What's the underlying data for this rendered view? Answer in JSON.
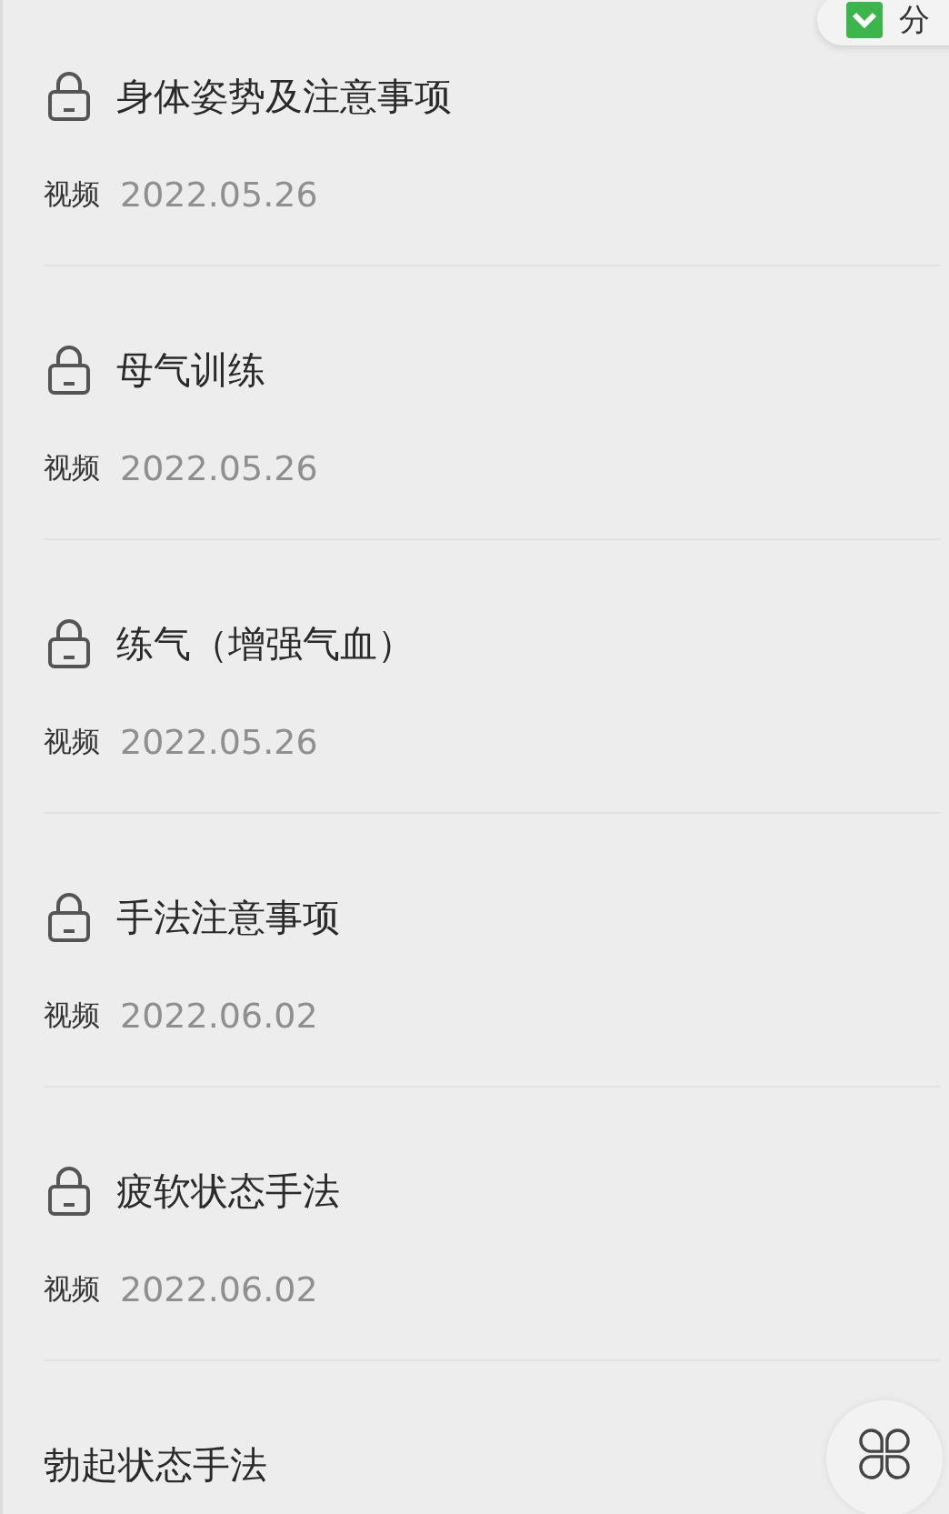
{
  "share_button": {
    "label": "分"
  },
  "lessons": [
    {
      "title": "身体姿势及注意事项",
      "locked": true,
      "type": "视频",
      "date": "2022.05.26"
    },
    {
      "title": "母气训练",
      "locked": true,
      "type": "视频",
      "date": "2022.05.26"
    },
    {
      "title": "练气（增强气血）",
      "locked": true,
      "type": "视频",
      "date": "2022.05.26"
    },
    {
      "title": "手法注意事项",
      "locked": true,
      "type": "视频",
      "date": "2022.06.02"
    },
    {
      "title": "疲软状态手法",
      "locked": true,
      "type": "视频",
      "date": "2022.06.02"
    },
    {
      "title": "勃起状态手法",
      "locked": false
    }
  ]
}
